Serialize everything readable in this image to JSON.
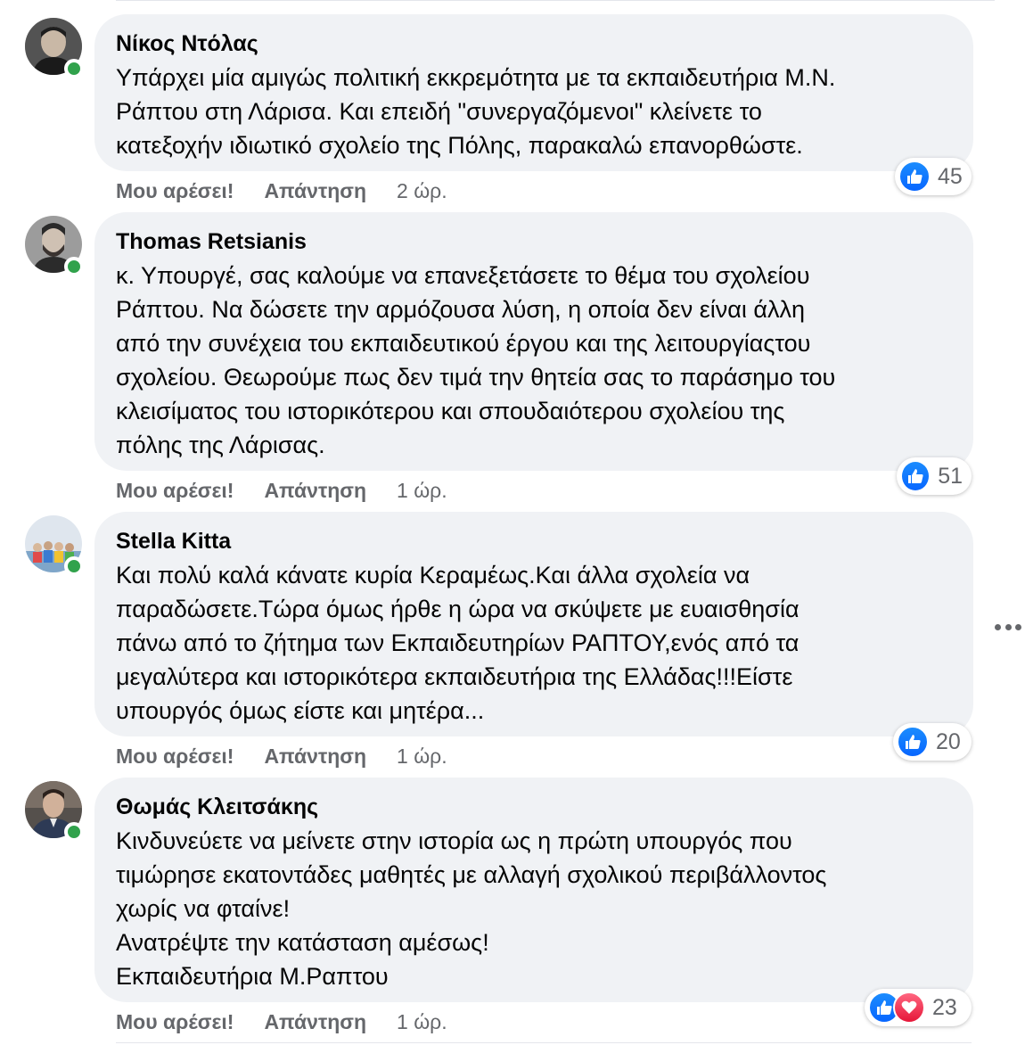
{
  "comments": [
    {
      "author": "Νίκος Ντόλας",
      "text": "Υπάρχει μία αμιγώς πολιτική εκκρεμότητα με τα εκπαιδευτήρια Μ.Ν.\nΡάπτου στη Λάρισα. Και επειδή \"συνεργαζόμενοι\" κλείνετε το\nκατεξοχήν ιδιωτικό σχολείο της Πόλης, παρακαλώ επανορθώστε.",
      "like_label": "Μου αρέσει!",
      "reply_label": "Απάντηση",
      "time": "2 ώρ.",
      "reaction_count": "45",
      "reaction_types": [
        "like-icon"
      ],
      "avatar_icon": "user-avatar"
    },
    {
      "author": "Thomas Retsianis",
      "text": "κ. Υπουργέ, σας καλούμε να επανεξετάσετε το θέμα του σχολείου\nΡάπτου. Να δώσετε την αρμόζουσα λύση, η οποία δεν είναι άλλη\nαπό την συνέχεια του εκπαιδευτικού έργου και της λειτουργίαςτου\nσχολείου. Θεωρούμε πως δεν τιμά την θητεία σας το παράσημο του\nκλεισίματος του ιστορικότερου και σπουδαιότερου σχολείου της\nπόλης της Λάρισας.",
      "like_label": "Μου αρέσει!",
      "reply_label": "Απάντηση",
      "time": "1 ώρ.",
      "reaction_count": "51",
      "reaction_types": [
        "like-icon"
      ],
      "avatar_icon": "user-avatar"
    },
    {
      "author": "Stella Kitta",
      "text": "Και πολύ καλά κάνατε κυρία Κεραμέως.Και άλλα σχολεία να\nπαραδώσετε.Τώρα όμως ήρθε η ώρα να σκύψετε με ευαισθησία\nπάνω από το ζήτημα των Εκπαιδευτηρίων ΡΑΠΤΟΥ,ενός από τα\nμεγαλύτερα και ιστορικότερα εκπαιδευτήρια της Ελλάδας!!!Είστε\nυπουργός όμως είστε και μητέρα...",
      "like_label": "Μου αρέσει!",
      "reply_label": "Απάντηση",
      "time": "1 ώρ.",
      "reaction_count": "20",
      "reaction_types": [
        "like-icon"
      ],
      "avatar_icon": "group-photo-avatar"
    },
    {
      "author": "Θωμάς Κλειτσάκης",
      "text": "Κινδυνεύετε να μείνετε στην ιστορία ως η πρώτη υπουργός που\nτιμώρησε εκατοντάδες μαθητές με αλλαγή σχολικού περιβάλλοντος\nχωρίς να φταίνε!\nΑνατρέψτε την κατάσταση αμέσως!\nΕκπαιδευτήρια Μ.Ραπτου",
      "like_label": "Μου αρέσει!",
      "reply_label": "Απάντηση",
      "time": "1 ώρ.",
      "reaction_count": "23",
      "reaction_types": [
        "like-icon",
        "love-icon"
      ],
      "avatar_icon": "user-avatar"
    }
  ],
  "colors": {
    "bubble": "#f0f2f5",
    "secondary_text": "#65676b",
    "online": "#31a24c",
    "like": "#0866ff",
    "love": "#e61739"
  },
  "more_icon": "more-options-icon"
}
